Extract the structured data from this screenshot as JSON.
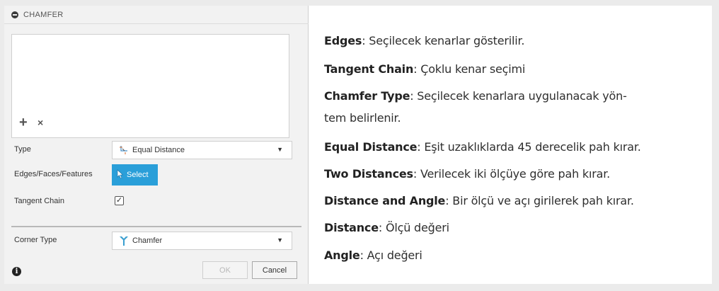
{
  "dialog": {
    "title": "CHAMFER",
    "add_symbol": "+",
    "remove_symbol": "×",
    "type": {
      "label": "Type",
      "value": "Equal Distance",
      "icon": "equal-distance-icon"
    },
    "edges": {
      "label": "Edges/Faces/Features",
      "button": "Select",
      "icon": "cursor-icon"
    },
    "tangent": {
      "label": "Tangent Chain",
      "checked": true,
      "check_glyph": "✓"
    },
    "corner": {
      "label": "Corner Type",
      "value": "Chamfer",
      "icon": "chamfer-corner-icon"
    },
    "ok_label": "OK",
    "cancel_label": "Cancel",
    "info_glyph": "i",
    "arrow_glyph": "▼",
    "accent_color": "#2a9fd9"
  },
  "description": [
    {
      "term": "Edges",
      "text": ": Seçilecek kenarlar gösterilir."
    },
    {
      "term": "Tangent Chain",
      "text": ": Çoklu kenar seçimi"
    },
    {
      "term": "Chamfer Type",
      "text": ": Seçilecek kenarlara uygulanacak yön-"
    },
    {
      "term": "",
      "text": "tem belirlenir."
    },
    {
      "term": "Equal Distance",
      "text": ": Eşit uzaklıklarda 45 derecelik pah kırar."
    },
    {
      "term": "Two Distances",
      "text": ": Verilecek iki ölçüye göre pah kırar."
    },
    {
      "term": "Distance and Angle",
      "text": ": Bir ölçü ve açı girilerek pah kırar."
    },
    {
      "term": "Distance",
      "text": ": Ölçü değeri"
    },
    {
      "term": "Angle",
      "text": ": Açı değeri"
    }
  ]
}
